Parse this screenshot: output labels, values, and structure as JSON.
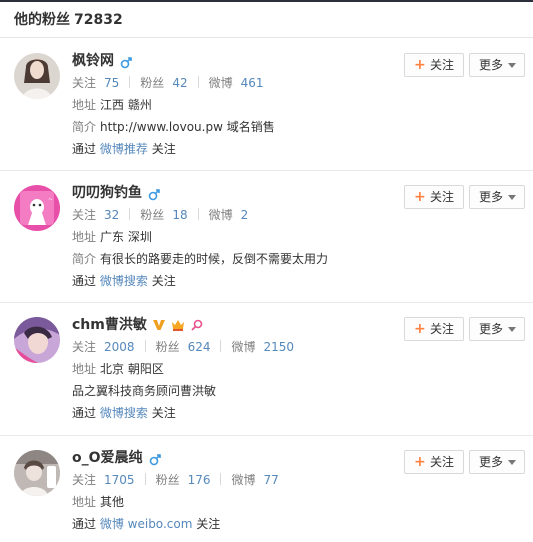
{
  "header": {
    "title": "他的粉丝",
    "count": "72832"
  },
  "fans": [
    {
      "name": "枫铃网",
      "gender": "male",
      "stats": [
        {
          "label": "关注",
          "value": "75"
        },
        {
          "label": "粉丝",
          "value": "42"
        },
        {
          "label": "微博",
          "value": "461"
        }
      ],
      "lines": [
        {
          "label": "地址",
          "text": "江西 赣州"
        },
        {
          "label": "简介",
          "text": "http://www.lovou.pw 域名销售"
        },
        {
          "prefix": "通过",
          "link": "微博推荐",
          "suffix": "关注"
        }
      ],
      "follow_label": "关注",
      "more_label": "更多"
    },
    {
      "name": "叨叨狗钓鱼",
      "gender": "male",
      "stats": [
        {
          "label": "关注",
          "value": "32"
        },
        {
          "label": "粉丝",
          "value": "18"
        },
        {
          "label": "微博",
          "value": "2"
        }
      ],
      "lines": [
        {
          "label": "地址",
          "text": "广东 深圳"
        },
        {
          "label": "简介",
          "text": "有很长的路要走的时候，反倒不需要太用力"
        },
        {
          "prefix": "通过",
          "link": "微博搜索",
          "suffix": "关注"
        }
      ],
      "follow_label": "关注",
      "more_label": "更多"
    },
    {
      "name": "chm曹洪敏",
      "gender": "female",
      "badges": [
        "verified-v-icon",
        "vip-crown-icon",
        "magnifier-badge-icon"
      ],
      "stats": [
        {
          "label": "关注",
          "value": "2008"
        },
        {
          "label": "粉丝",
          "value": "624"
        },
        {
          "label": "微博",
          "value": "2150"
        }
      ],
      "lines": [
        {
          "label": "地址",
          "text": "北京 朝阳区"
        },
        {
          "text": "品之翼科技商务顾问曹洪敏"
        },
        {
          "prefix": "通过",
          "link": "微博搜索",
          "suffix": "关注"
        }
      ],
      "follow_label": "关注",
      "more_label": "更多"
    },
    {
      "name": "o_O爱晨纯",
      "gender": "male",
      "stats": [
        {
          "label": "关注",
          "value": "1705"
        },
        {
          "label": "粉丝",
          "value": "176"
        },
        {
          "label": "微博",
          "value": "77"
        }
      ],
      "lines": [
        {
          "label": "地址",
          "text": "其他"
        },
        {
          "prefix": "通过",
          "link": "微博 weibo.com",
          "suffix": "关注"
        }
      ],
      "follow_label": "关注",
      "more_label": "更多"
    }
  ],
  "colors": {
    "link": "#5588bb",
    "male": "#3d9ae0",
    "female": "#f05e8f",
    "plus": "#ff8140",
    "verified": "#f0a020"
  }
}
